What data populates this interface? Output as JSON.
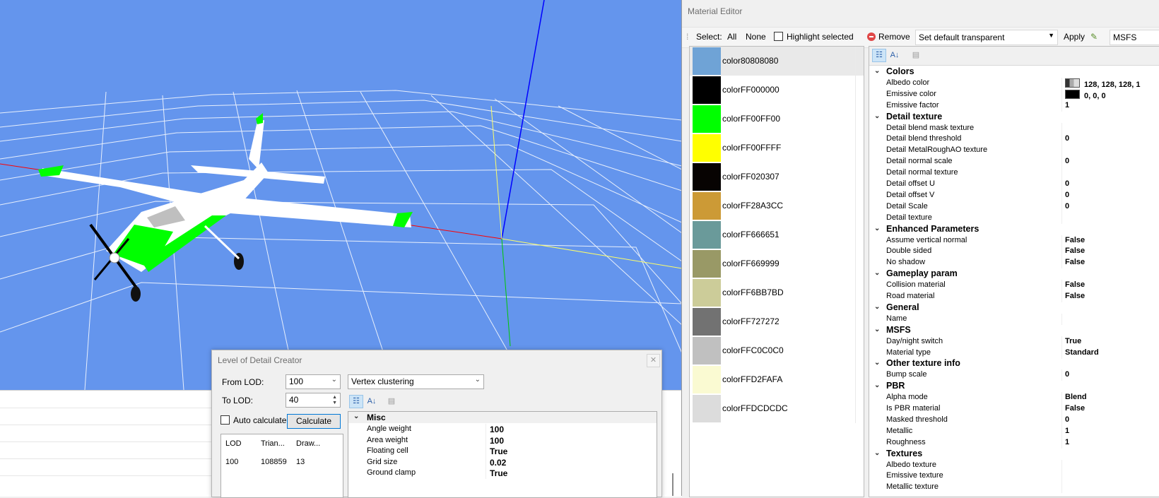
{
  "material_editor": {
    "title": "Material Editor",
    "toolbar": {
      "select_label": "Select:",
      "all_label": "All",
      "none_label": "None",
      "highlight_label": "Highlight selected",
      "remove_label": "Remove",
      "preset_value": "Set default transparent",
      "apply_label": "Apply",
      "sim_value": "MSFS"
    },
    "materials": [
      {
        "name": "color80808080",
        "color": "#6FA3D6"
      },
      {
        "name": "colorFF000000",
        "color": "#000000"
      },
      {
        "name": "colorFF00FF00",
        "color": "#00FF00"
      },
      {
        "name": "colorFF00FFFF",
        "color": "#FFFF00"
      },
      {
        "name": "colorFF020307",
        "color": "#070302"
      },
      {
        "name": "colorFF28A3CC",
        "color": "#CC9A36"
      },
      {
        "name": "colorFF666651",
        "color": "#6A9A9A"
      },
      {
        "name": "colorFF669999",
        "color": "#999966"
      },
      {
        "name": "colorFF6BB7BD",
        "color": "#CCCC99"
      },
      {
        "name": "colorFF727272",
        "color": "#727272"
      },
      {
        "name": "colorFFC0C0C0",
        "color": "#C0C0C0"
      },
      {
        "name": "colorFFD2FAFA",
        "color": "#FAFAD2"
      },
      {
        "name": "colorFFDCDCDC",
        "color": "#DCDCDC"
      }
    ],
    "properties": [
      {
        "kind": "cat",
        "name": "Colors"
      },
      {
        "kind": "prop",
        "name": "Albedo color",
        "value": "128, 128, 128, 1",
        "swatch": "albedo"
      },
      {
        "kind": "prop",
        "name": "Emissive color",
        "value": "0, 0, 0",
        "swatch": "emissive"
      },
      {
        "kind": "prop",
        "name": "Emissive factor",
        "value": "1"
      },
      {
        "kind": "cat",
        "name": "Detail texture"
      },
      {
        "kind": "prop",
        "name": "Detail blend mask texture",
        "value": ""
      },
      {
        "kind": "prop",
        "name": "Detail blend threshold",
        "value": "0"
      },
      {
        "kind": "prop",
        "name": "Detail MetalRoughAO texture",
        "value": ""
      },
      {
        "kind": "prop",
        "name": "Detail normal scale",
        "value": "0"
      },
      {
        "kind": "prop",
        "name": "Detail normal texture",
        "value": ""
      },
      {
        "kind": "prop",
        "name": "Detail offset U",
        "value": "0"
      },
      {
        "kind": "prop",
        "name": "Detail offset V",
        "value": "0"
      },
      {
        "kind": "prop",
        "name": "Detail Scale",
        "value": "0"
      },
      {
        "kind": "prop",
        "name": "Detail texture",
        "value": ""
      },
      {
        "kind": "cat",
        "name": "Enhanced Parameters"
      },
      {
        "kind": "prop",
        "name": "Assume vertical normal",
        "value": "False"
      },
      {
        "kind": "prop",
        "name": "Double sided",
        "value": "False"
      },
      {
        "kind": "prop",
        "name": "No shadow",
        "value": "False"
      },
      {
        "kind": "cat",
        "name": "Gameplay param"
      },
      {
        "kind": "prop",
        "name": "Collision material",
        "value": "False"
      },
      {
        "kind": "prop",
        "name": "Road material",
        "value": "False"
      },
      {
        "kind": "cat",
        "name": "General"
      },
      {
        "kind": "prop",
        "name": "Name",
        "value": ""
      },
      {
        "kind": "cat",
        "name": "MSFS"
      },
      {
        "kind": "prop",
        "name": "Day/night switch",
        "value": "True"
      },
      {
        "kind": "prop",
        "name": "Material type",
        "value": "Standard"
      },
      {
        "kind": "cat",
        "name": "Other texture info"
      },
      {
        "kind": "prop",
        "name": "Bump scale",
        "value": "0"
      },
      {
        "kind": "cat",
        "name": "PBR"
      },
      {
        "kind": "prop",
        "name": "Alpha mode",
        "value": "Blend"
      },
      {
        "kind": "prop",
        "name": "Is PBR material",
        "value": "False"
      },
      {
        "kind": "prop",
        "name": "Masked threshold",
        "value": "0"
      },
      {
        "kind": "prop",
        "name": "Metallic",
        "value": "1"
      },
      {
        "kind": "prop",
        "name": "Roughness",
        "value": "1"
      },
      {
        "kind": "cat",
        "name": "Textures"
      },
      {
        "kind": "prop",
        "name": "Albedo texture",
        "value": ""
      },
      {
        "kind": "prop",
        "name": "Emissive texture",
        "value": ""
      },
      {
        "kind": "prop",
        "name": "Metallic texture",
        "value": ""
      }
    ]
  },
  "lod_creator": {
    "title": "Level of Detail Creator",
    "from_lod_label": "From LOD:",
    "from_lod_value": "100",
    "method_value": "Vertex clustering",
    "to_lod_label": "To LOD:",
    "to_lod_value": "40",
    "auto_calculate_label": "Auto calculate",
    "calculate_label": "Calculate",
    "table": {
      "headers": [
        "LOD",
        "Trian...",
        "Draw..."
      ],
      "rows": [
        [
          "100",
          "108859",
          "13"
        ]
      ]
    },
    "category": "Misc",
    "properties": [
      {
        "name": "Angle weight",
        "value": "100"
      },
      {
        "name": "Area weight",
        "value": "100"
      },
      {
        "name": "Floating cell",
        "value": "True"
      },
      {
        "name": "Grid size",
        "value": "0.02"
      },
      {
        "name": "Ground clamp",
        "value": "True"
      }
    ]
  },
  "colors": {
    "viewport_bg": "#6495ED",
    "axis_x": "#FF0000",
    "axis_y": "#00C800",
    "axis_z": "#0000FF",
    "grid": "#FFFFFF",
    "plane_body": "#FFFFFF",
    "plane_accent": "#00FF00"
  }
}
